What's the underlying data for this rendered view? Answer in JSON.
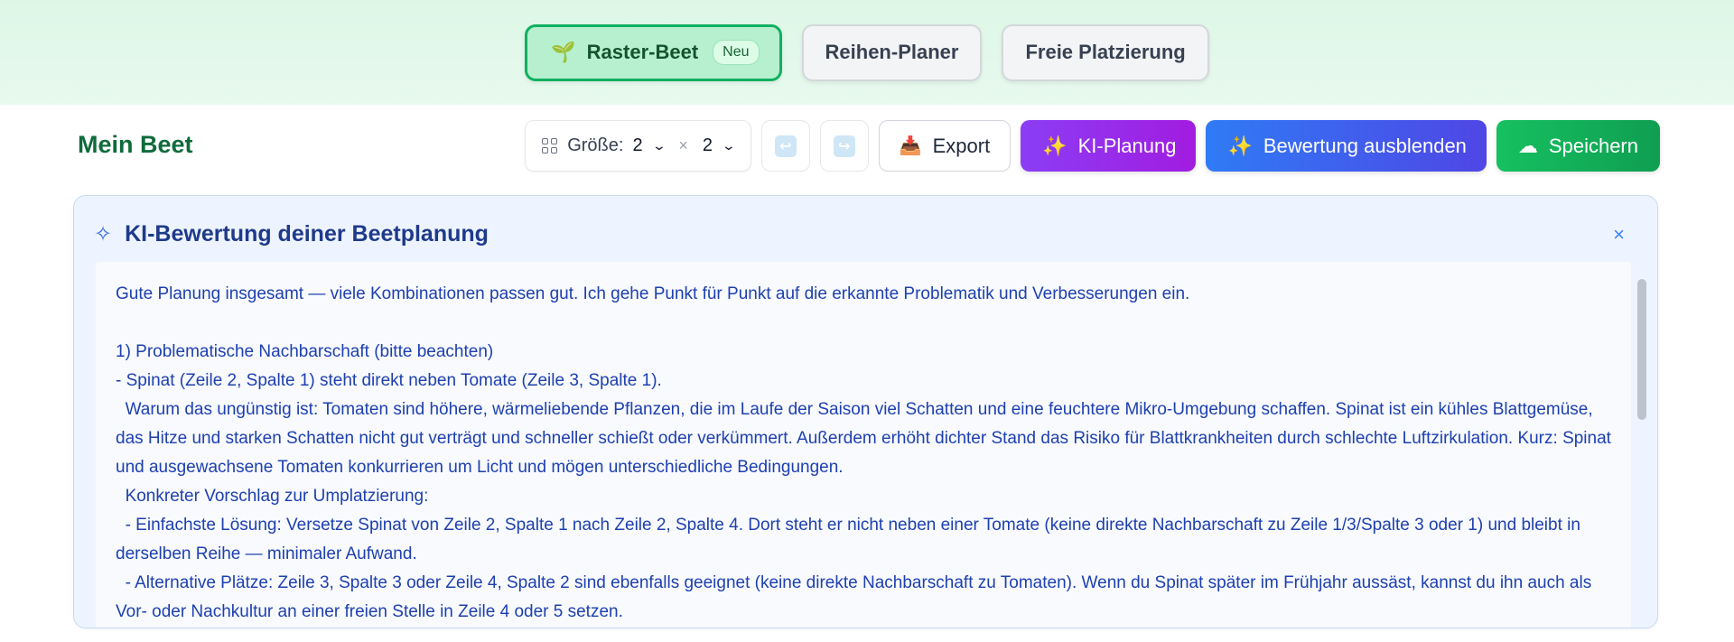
{
  "modes": {
    "raster": {
      "label": "Raster-Beet",
      "badge": "Neu",
      "icon": "sprout-icon"
    },
    "reihen": {
      "label": "Reihen-Planer"
    },
    "frei": {
      "label": "Freie Platzierung"
    }
  },
  "beet": {
    "title": "Mein Beet"
  },
  "toolbar": {
    "size_label": "Größe:",
    "rows": "2",
    "times": "×",
    "cols": "2",
    "export_label": "Export",
    "ki_label": "KI-Planung",
    "bewertung_label": "Bewertung ausblenden",
    "save_label": "Speichern",
    "colors": {
      "ki": "#9b30f0",
      "bewertung": "#3b6cf2",
      "save": "#12b45a"
    }
  },
  "panel": {
    "title": "KI-Bewertung deiner Beetplanung",
    "close": "×",
    "lines": [
      "Gute Planung insgesamt — viele Kombinationen passen gut. Ich gehe Punkt für Punkt auf die erkannte Problematik und Verbesserungen ein.",
      "",
      "1) Problematische Nachbarschaft (bitte beachten)",
      "- Spinat (Zeile 2, Spalte 1) steht direkt neben Tomate (Zeile 3, Spalte 1).",
      "  Warum das ungünstig ist: Tomaten sind höhere, wärmeliebende Pflanzen, die im Laufe der Saison viel Schatten und eine feuchtere Mikro-Umgebung schaffen. Spinat ist ein kühles Blattgemüse, das Hitze und starken Schatten nicht gut verträgt und schneller schießt oder verkümmert. Außerdem erhöht dichter Stand das Risiko für Blattkrankheiten durch schlechte Luftzirkulation. Kurz: Spinat und ausgewachsene Tomaten konkurrieren um Licht und mögen unterschiedliche Bedingungen.",
      "  Konkreter Vorschlag zur Umplatzierung:",
      "  - Einfachste Lösung: Versetze Spinat von Zeile 2, Spalte 1 nach Zeile 2, Spalte 4. Dort steht er nicht neben einer Tomate (keine direkte Nachbarschaft zu Zeile 1/3/Spalte 3 oder 1) und bleibt in derselben Reihe — minimaler Aufwand.",
      "  - Alternative Plätze: Zeile 3, Spalte 3 oder Zeile 4, Spalte 2 sind ebenfalls geeignet (keine direkte Nachbarschaft zu Tomaten). Wenn du Spinat später im Frühjahr aussäst, kannst du ihn auch als Vor- oder Nachkultur an einer freien Stelle in Zeile 4 oder 5 setzen."
    ]
  }
}
